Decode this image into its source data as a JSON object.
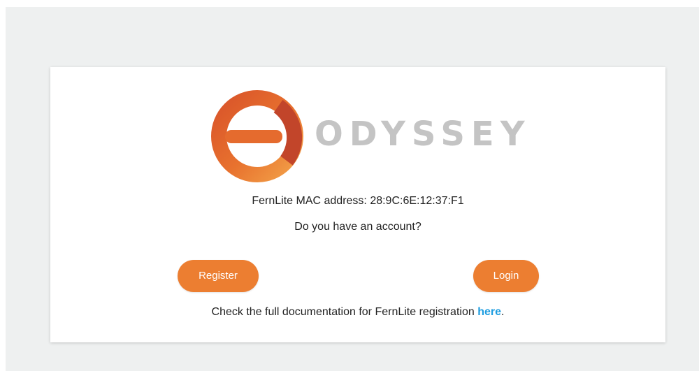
{
  "brand": {
    "name": "ODYSSEY",
    "logo_icon": "odyssey-ring-logo",
    "accent_color": "#ec7e31",
    "wordmark_color": "#c4c4c4"
  },
  "card": {
    "mac_label": "FernLite MAC address: 28:9C:6E:12:37:F1",
    "question": "Do you have an account?",
    "register_label": "Register",
    "login_label": "Login",
    "doc_text": "Check the full documentation for FernLite registration ",
    "doc_link_label": "here",
    "doc_suffix": ".",
    "link_color": "#1e9de0"
  }
}
